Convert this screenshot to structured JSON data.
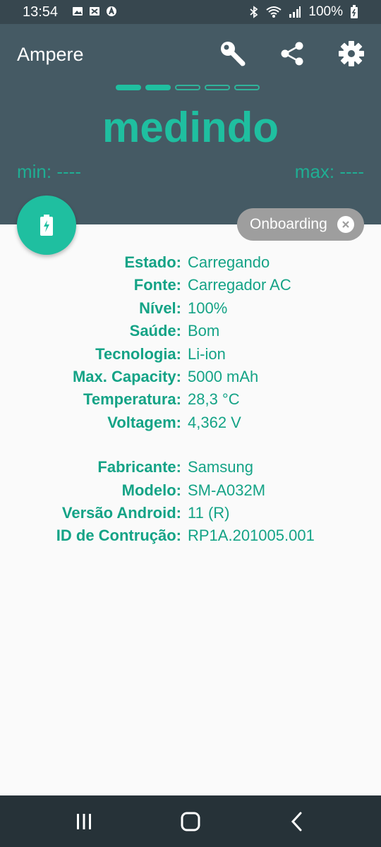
{
  "status_bar": {
    "time": "13:54",
    "battery": "100%",
    "left_icons": [
      "image-icon",
      "sync-icon",
      "shield-a-icon"
    ],
    "right_icons": [
      "bluetooth-icon",
      "wifi-icon",
      "signal-icon",
      "battery-charging-icon"
    ]
  },
  "header": {
    "title": "Ampere",
    "actions": [
      "key-icon",
      "share-icon",
      "settings-gear-icon"
    ],
    "progress_dots": {
      "filled": 2,
      "total": 5
    },
    "status_word": "medindo",
    "min_label": "min: ----",
    "max_label": "max: ----",
    "accent_color": "#1fbfa0",
    "background_color": "#455a64"
  },
  "fab": {
    "icon": "battery-charging-icon"
  },
  "chip": {
    "label": "Onboarding",
    "icon": "close-circle-icon"
  },
  "battery_info": [
    {
      "label": "Estado:",
      "value": "Carregando"
    },
    {
      "label": "Fonte:",
      "value": "Carregador AC"
    },
    {
      "label": "Nível:",
      "value": "100%"
    },
    {
      "label": "Saúde:",
      "value": "Bom"
    },
    {
      "label": "Tecnologia:",
      "value": "Li-ion"
    },
    {
      "label": "Max. Capacity:",
      "value": "5000 mAh"
    },
    {
      "label": "Temperatura:",
      "value": "28,3 °C"
    },
    {
      "label": "Voltagem:",
      "value": "4,362 V"
    }
  ],
  "device_info": [
    {
      "label": "Fabricante:",
      "value": "Samsung"
    },
    {
      "label": "Modelo:",
      "value": "SM-A032M"
    },
    {
      "label": "Versão Android:",
      "value": "11 (R)"
    },
    {
      "label": "ID de Contrução:",
      "value": "RP1A.201005.001"
    }
  ],
  "nav_bar": {
    "buttons": [
      "recent-apps-icon",
      "home-icon",
      "back-icon"
    ]
  }
}
